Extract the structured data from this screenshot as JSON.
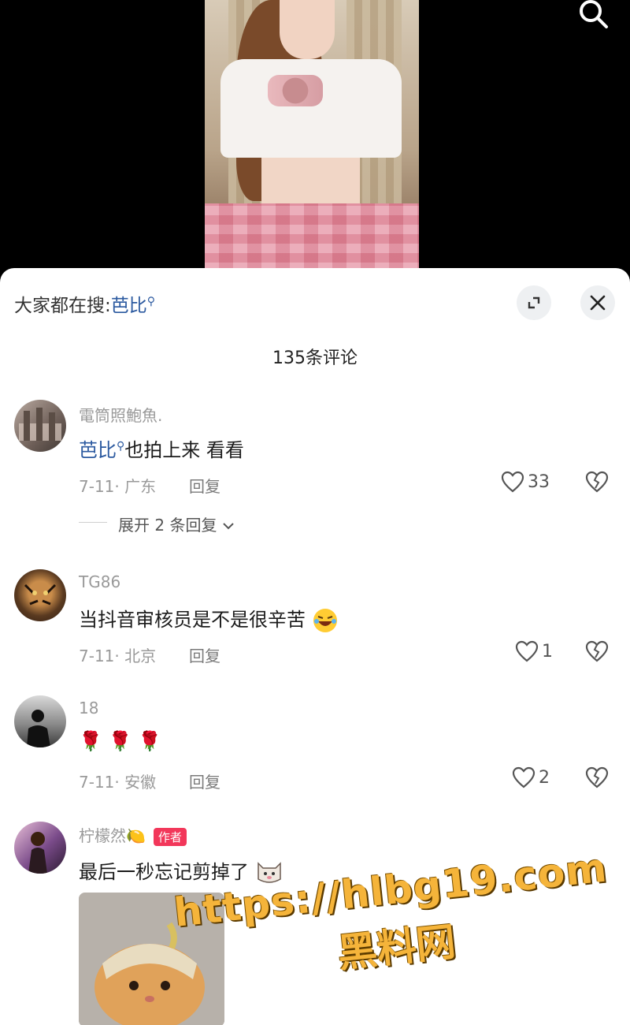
{
  "video": {
    "search_icon": "search-icon"
  },
  "panel": {
    "search_prefix": "大家都在搜:",
    "search_term": "芭比",
    "search_glyph": "⚲",
    "expand_icon": "fullscreen-icon",
    "close_icon": "close-icon",
    "comment_count_title": "135条评论"
  },
  "comments": [
    {
      "username": "電筒照鮑魚.",
      "text_link": "芭比",
      "text_link_glyph": "⚲",
      "text": "也拍上来 看看",
      "date_location": "7-11· 广东",
      "reply": "回复",
      "likes": "33",
      "expand_label": "展开 2 条回复"
    },
    {
      "username": "TG86",
      "text": "当抖音审核员是不是很辛苦",
      "emoji": "rolling-laughing-emoji",
      "date_location": "7-11· 北京",
      "reply": "回复",
      "likes": "1"
    },
    {
      "username": "18",
      "text": "🌹 🌹 🌹",
      "date_location": "7-11· 安徽",
      "reply": "回复",
      "likes": "2"
    },
    {
      "username": "柠檬然",
      "username_emoji": "🍋",
      "author_tag": "作者",
      "text": "最后一秒忘记剪掉了",
      "emoji": "cat-face-emoji"
    }
  ],
  "watermark": {
    "url": "https://hlbg19.com",
    "site": "黑料网"
  },
  "colors": {
    "link_blue": "#2c5aa0",
    "author_tag": "#f2375a",
    "watermark": "#f5b43a"
  }
}
